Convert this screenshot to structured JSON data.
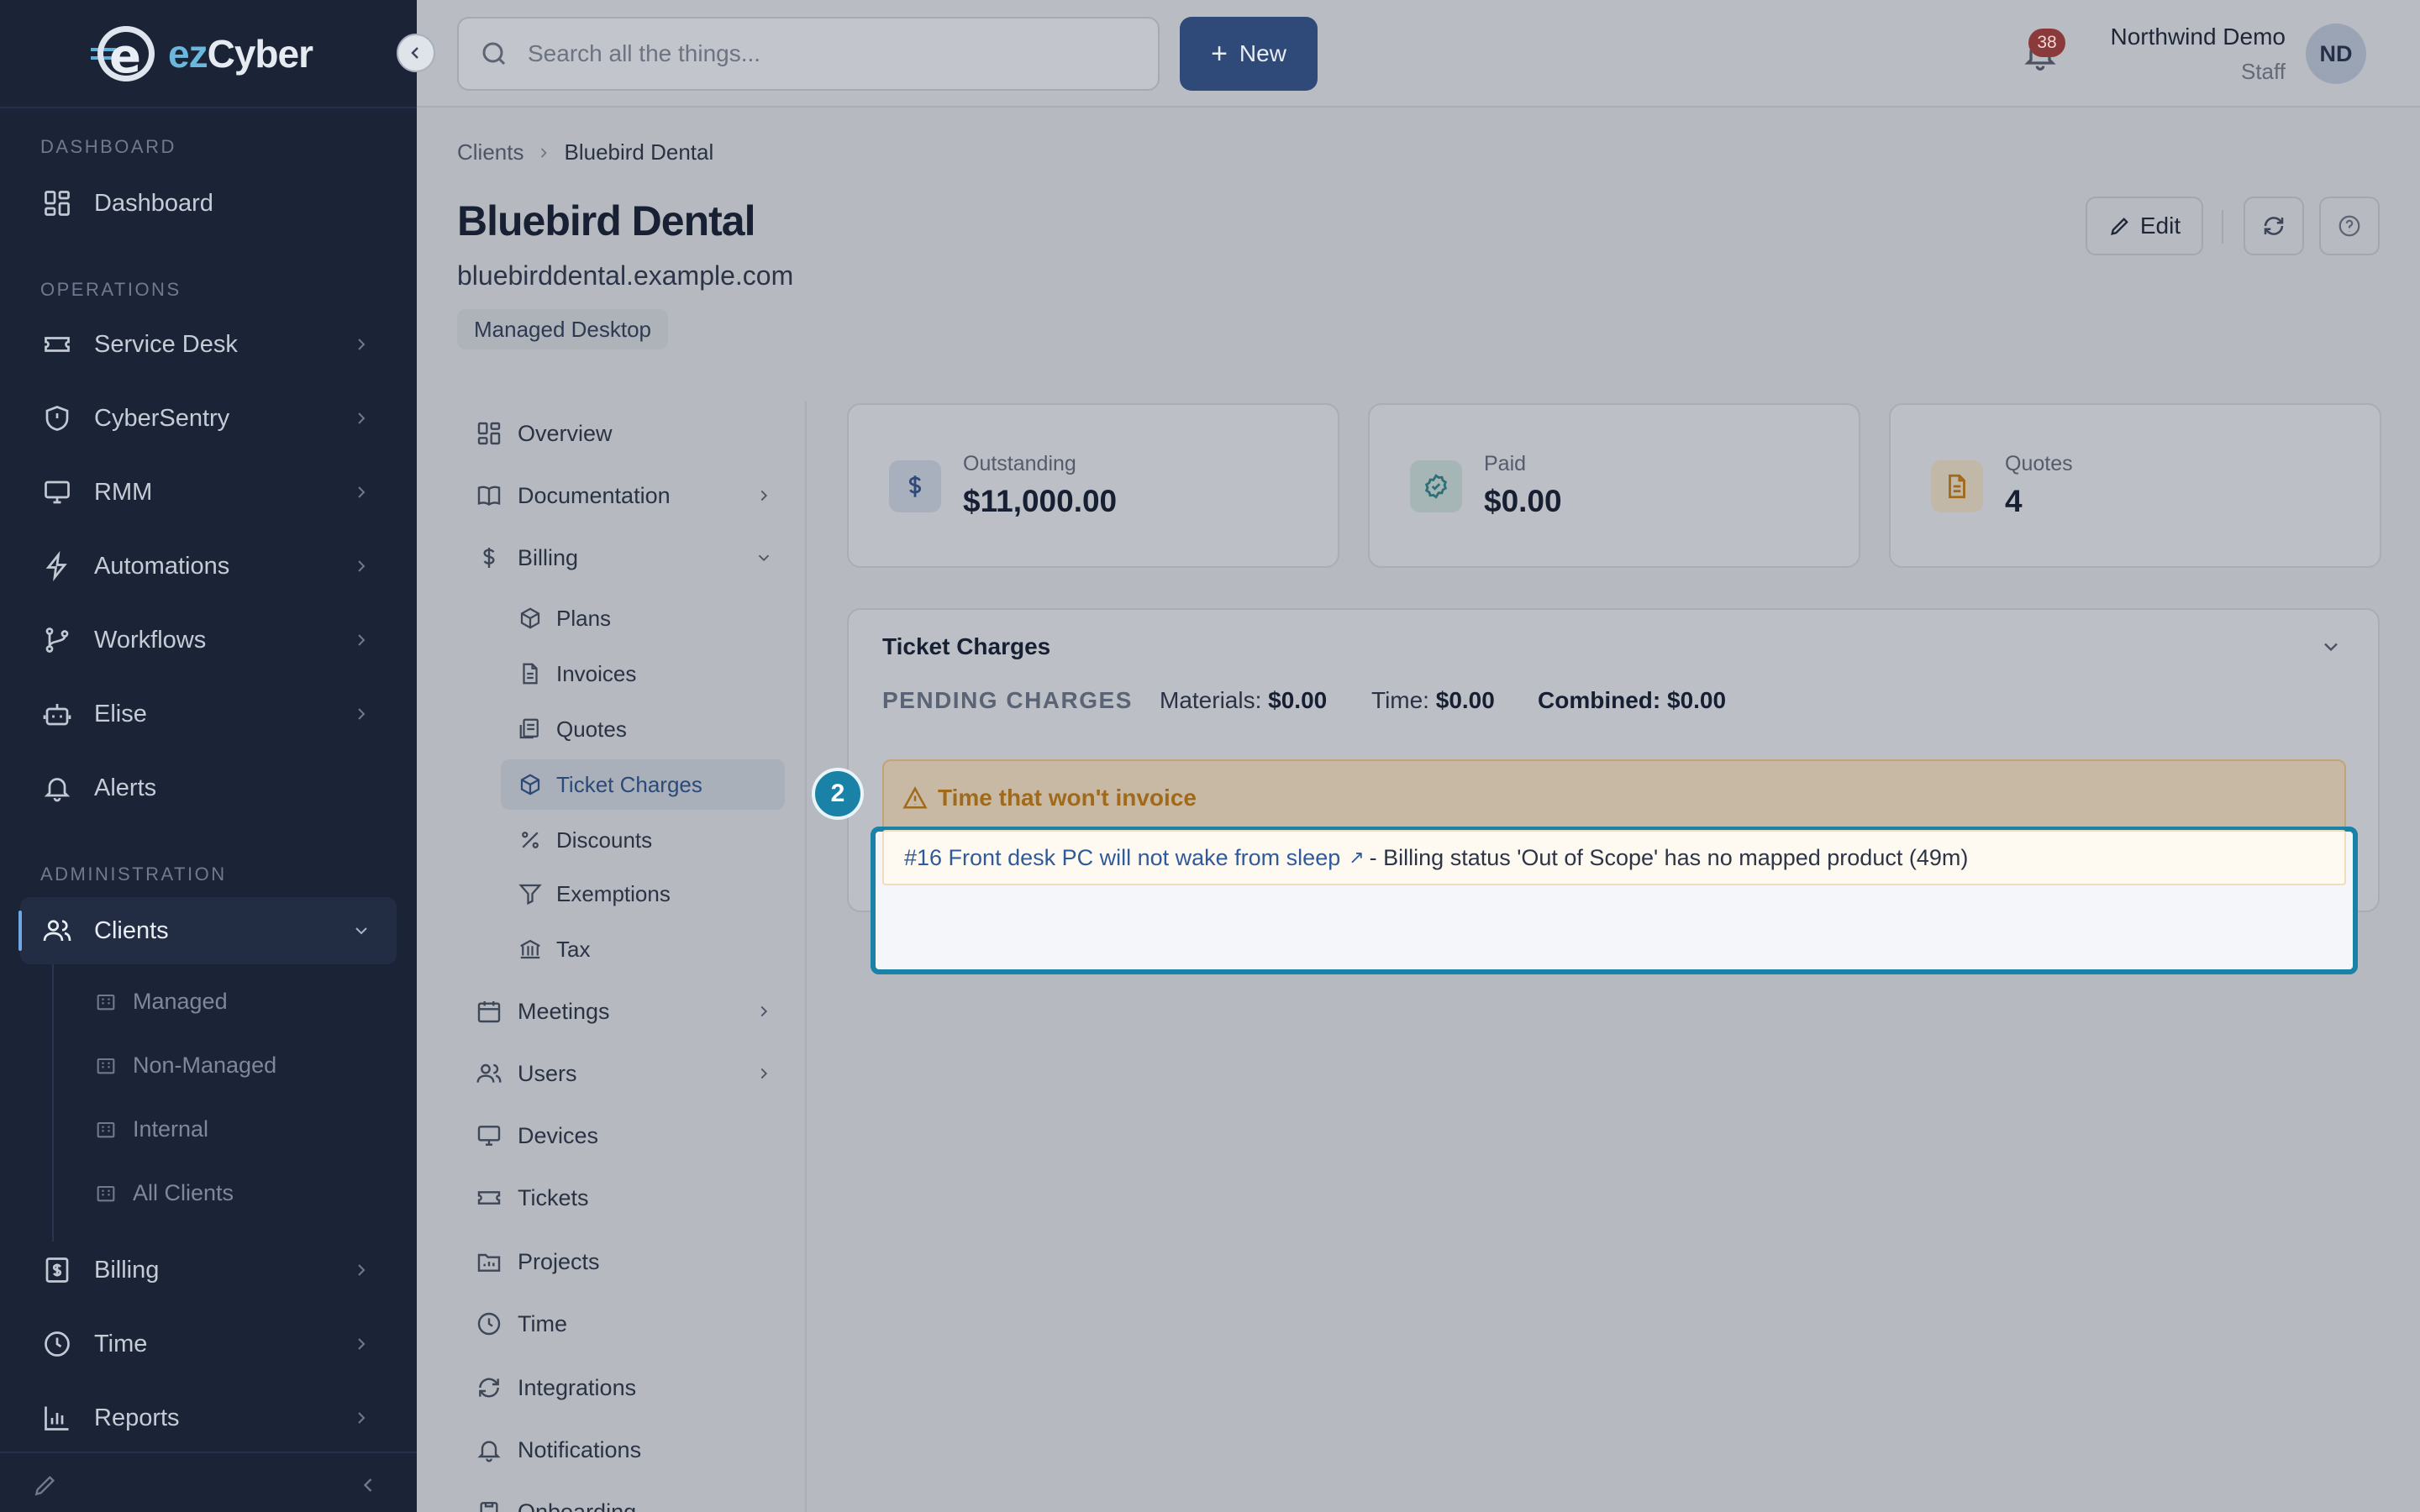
{
  "brand": {
    "logo_text_a": "ez",
    "logo_text_b": "Cyber"
  },
  "sidebar": {
    "sections": [
      "DASHBOARD",
      "OPERATIONS",
      "ADMINISTRATION"
    ],
    "items": [
      {
        "label": "Dashboard",
        "icon": "grid-icon"
      },
      {
        "label": "Service Desk",
        "icon": "ticket-icon"
      },
      {
        "label": "CyberSentry",
        "icon": "shield-icon"
      },
      {
        "label": "RMM",
        "icon": "monitor-icon"
      },
      {
        "label": "Automations",
        "icon": "bolt-icon"
      },
      {
        "label": "Workflows",
        "icon": "branch-icon"
      },
      {
        "label": "Elise",
        "icon": "bot-icon"
      },
      {
        "label": "Alerts",
        "icon": "bell-icon"
      },
      {
        "label": "Clients",
        "icon": "users-icon"
      },
      {
        "label": "Billing",
        "icon": "invoice-icon"
      },
      {
        "label": "Time",
        "icon": "clock-icon"
      },
      {
        "label": "Reports",
        "icon": "bar-chart-icon"
      }
    ],
    "clients_sub": [
      "Managed",
      "Non-Managed",
      "Internal",
      "All Clients"
    ]
  },
  "topbar": {
    "search_placeholder": "Search all the things...",
    "new_label": "New",
    "notification_count": "38",
    "user_name": "Northwind Demo",
    "user_role": "Staff",
    "avatar_initials": "ND"
  },
  "page": {
    "breadcrumb": [
      "Clients",
      "Bluebird Dental"
    ],
    "title": "Bluebird Dental",
    "domain": "bluebirddental.example.com",
    "tag": "Managed Desktop",
    "edit_label": "Edit"
  },
  "subnav": {
    "items": [
      "Overview",
      "Documentation",
      "Billing",
      "Meetings",
      "Users",
      "Devices",
      "Tickets",
      "Projects",
      "Time",
      "Integrations",
      "Notifications",
      "Onboarding"
    ],
    "billing_sub": [
      "Plans",
      "Invoices",
      "Quotes",
      "Ticket Charges",
      "Discounts",
      "Exemptions",
      "Tax"
    ]
  },
  "stats": [
    {
      "label": "Outstanding",
      "value": "$11,000.00",
      "icon": "dollar-icon"
    },
    {
      "label": "Paid",
      "value": "$0.00",
      "icon": "check-badge-icon"
    },
    {
      "label": "Quotes",
      "value": "4",
      "icon": "document-icon"
    }
  ],
  "ticket_charges": {
    "title": "Ticket Charges",
    "pending_label": "PENDING CHARGES",
    "materials_label": "Materials:",
    "materials_value": "$0.00",
    "time_label": "Time:",
    "time_value": "$0.00",
    "combined_label": "Combined:",
    "combined_value": "$0.00",
    "warning_title": "Time that won't invoice",
    "row_link": "#16 Front desk PC will not wake from sleep",
    "row_text": "- Billing status 'Out of Scope' has no mapped product (49m)"
  },
  "step_marker": "2",
  "colors": {
    "accent": "#1a82a7",
    "primary_button": "#2f4a78",
    "warning": "#a16a1b"
  }
}
